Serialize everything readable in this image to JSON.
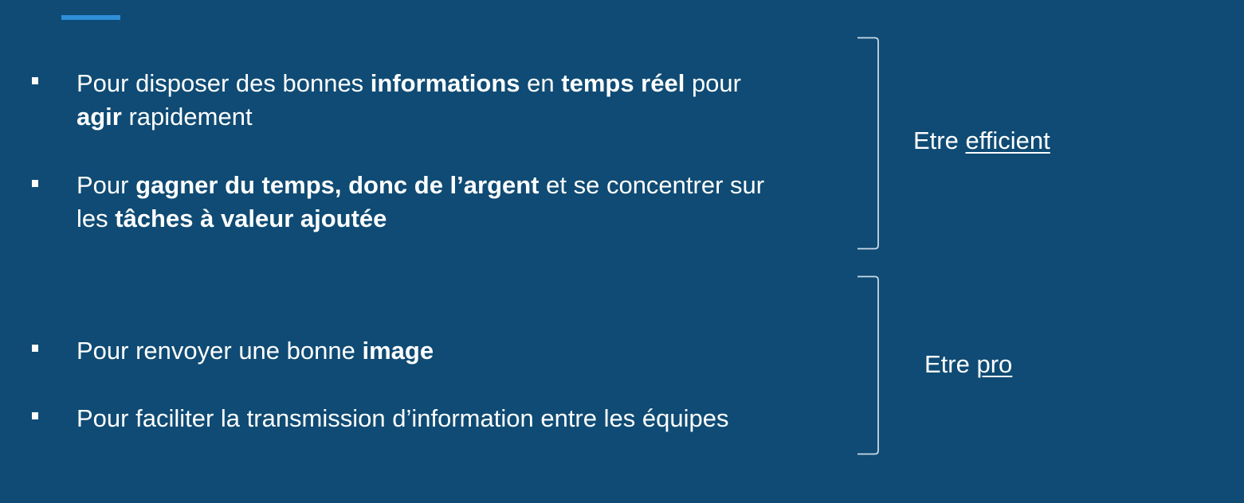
{
  "slide": {
    "colors": {
      "background": "#0f4b74",
      "accent": "#2f8fd8",
      "text": "#ffffff"
    },
    "groups": [
      {
        "items": [
          {
            "parts": [
              {
                "text": "Pour disposer des bonnes ",
                "bold": false
              },
              {
                "text": "informations",
                "bold": true
              },
              {
                "text": " en ",
                "bold": false
              },
              {
                "text": "temps réel",
                "bold": true
              },
              {
                "text": " pour",
                "bold": false
              },
              {
                "text": "\n",
                "bold": false
              },
              {
                "text": "agir",
                "bold": true
              },
              {
                "text": " rapidement",
                "bold": false
              }
            ]
          },
          {
            "parts": [
              {
                "text": "Pour ",
                "bold": false
              },
              {
                "text": "gagner du temps, donc de l’argent",
                "bold": true
              },
              {
                "text": " et se concentrer sur",
                "bold": false
              },
              {
                "text": "\n",
                "bold": false
              },
              {
                "text": "les ",
                "bold": false
              },
              {
                "text": "tâches à valeur ajoutée",
                "bold": true
              }
            ]
          }
        ],
        "label_prefix": "Etre ",
        "label_underlined": "efficient"
      },
      {
        "items": [
          {
            "parts": [
              {
                "text": "Pour renvoyer une bonne ",
                "bold": false
              },
              {
                "text": "image",
                "bold": true
              }
            ]
          },
          {
            "parts": [
              {
                "text": "Pour faciliter la transmission d’information entre les équipes",
                "bold": false
              }
            ]
          }
        ],
        "label_prefix": "Etre ",
        "label_underlined": "pro"
      }
    ]
  }
}
